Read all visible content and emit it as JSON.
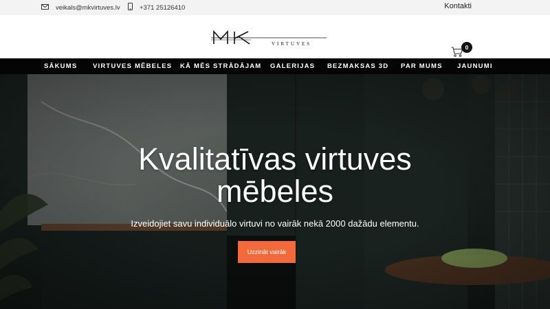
{
  "topbar": {
    "email": "veikals@mkvirtuves.lv",
    "phone": "+371 25126410",
    "contacts_link": "Kontakti"
  },
  "header": {
    "logo_text": "MK",
    "logo_subtext": "VIRTUVES",
    "cart_count": "0"
  },
  "nav": {
    "items": [
      {
        "label": "SĀKUMS"
      },
      {
        "label": "VIRTUVES MĒBELES"
      },
      {
        "label": "KĀ MĒS STRĀDĀJAM"
      },
      {
        "label": "GALERIJAS"
      },
      {
        "label": "BEZMAKSAS 3D"
      },
      {
        "label": "PAR MUMS"
      },
      {
        "label": "JAUNUMI"
      }
    ]
  },
  "hero": {
    "title_line1": "Kvalitatīvas virtuves",
    "title_line2": "mēbeles",
    "subtitle": "Izveidojiet savu individuālo virtuvi no vairāk nekā 2000 dažādu elementu.",
    "cta_label": "Uzzināt vairāk"
  },
  "colors": {
    "accent": "#f26a3b",
    "nav_bg": "#050505",
    "topbar_bg": "#f3f3f3"
  },
  "icons": {
    "email": "envelope-icon",
    "phone": "mobile-phone-icon",
    "cart": "shopping-cart-icon"
  }
}
